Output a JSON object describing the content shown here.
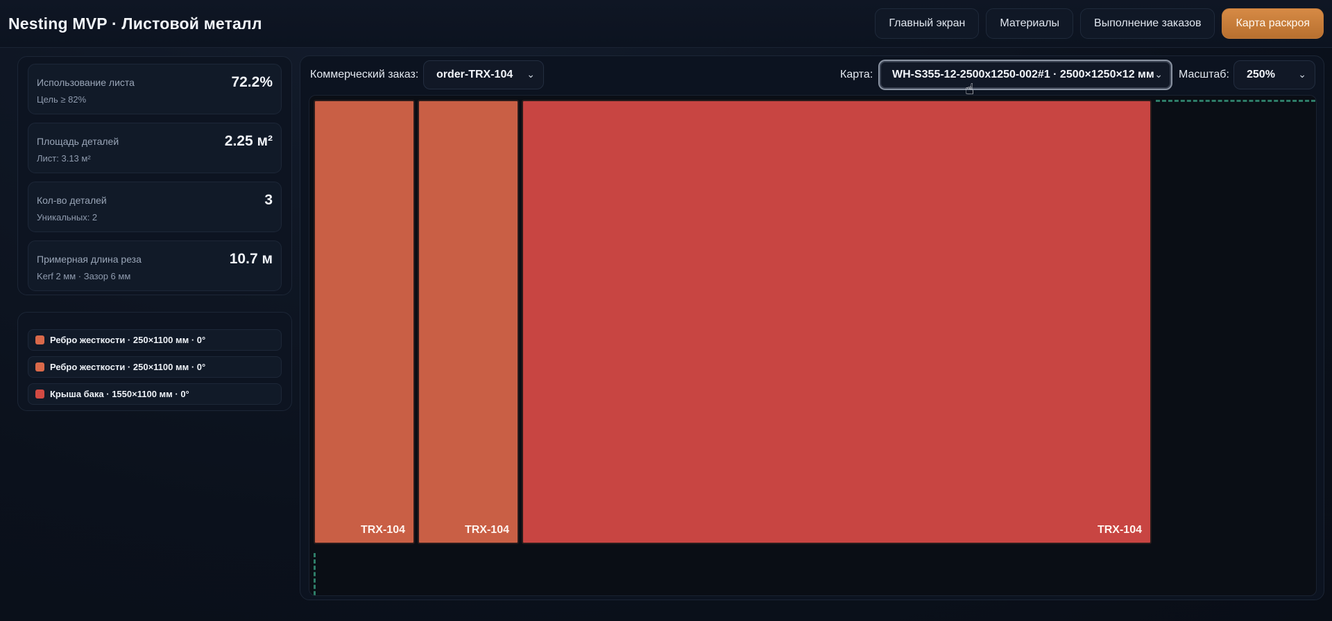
{
  "header": {
    "title": "Nesting MVP · Листовой металл",
    "nav": [
      {
        "label": "Главный экран"
      },
      {
        "label": "Материалы"
      },
      {
        "label": "Выполнение заказов"
      },
      {
        "label": "Карта раскроя"
      }
    ]
  },
  "stats": [
    {
      "label": "Использование листа",
      "sub": "Цель ≥ 82%",
      "value": "72.2%"
    },
    {
      "label": "Площадь деталей",
      "sub": "Лист: 3.13 м²",
      "value": "2.25 м²"
    },
    {
      "label": "Кол-во деталей",
      "sub": "Уникальных: 2",
      "value": "3"
    },
    {
      "label": "Примерная длина реза",
      "sub": "Kerf 2 мм · Зазор 6 мм",
      "value": "10.7 м"
    }
  ],
  "legend": [
    {
      "label": "Ребро жесткости · 250×1100 мм · 0°",
      "color": "#d9694a"
    },
    {
      "label": "Ребро жесткости · 250×1100 мм · 0°",
      "color": "#d9694a"
    },
    {
      "label": "Крыша бака · 1550×1100 мм · 0°",
      "color": "#d14a43"
    }
  ],
  "toolbar": {
    "order_label": "Коммерческий заказ:",
    "order_value": "order-TRX-104",
    "map_label": "Карта:",
    "map_value": "WH-S355-12-2500x1250-002#1 · 2500×1250×12 мм",
    "scale_label": "Масштаб:",
    "scale_value": "250%"
  },
  "parts": [
    {
      "label": "TRX-104",
      "color": "#c95f45"
    },
    {
      "label": "TRX-104",
      "color": "#c95f45"
    },
    {
      "label": "TRX-104",
      "color": "#c84542"
    }
  ]
}
